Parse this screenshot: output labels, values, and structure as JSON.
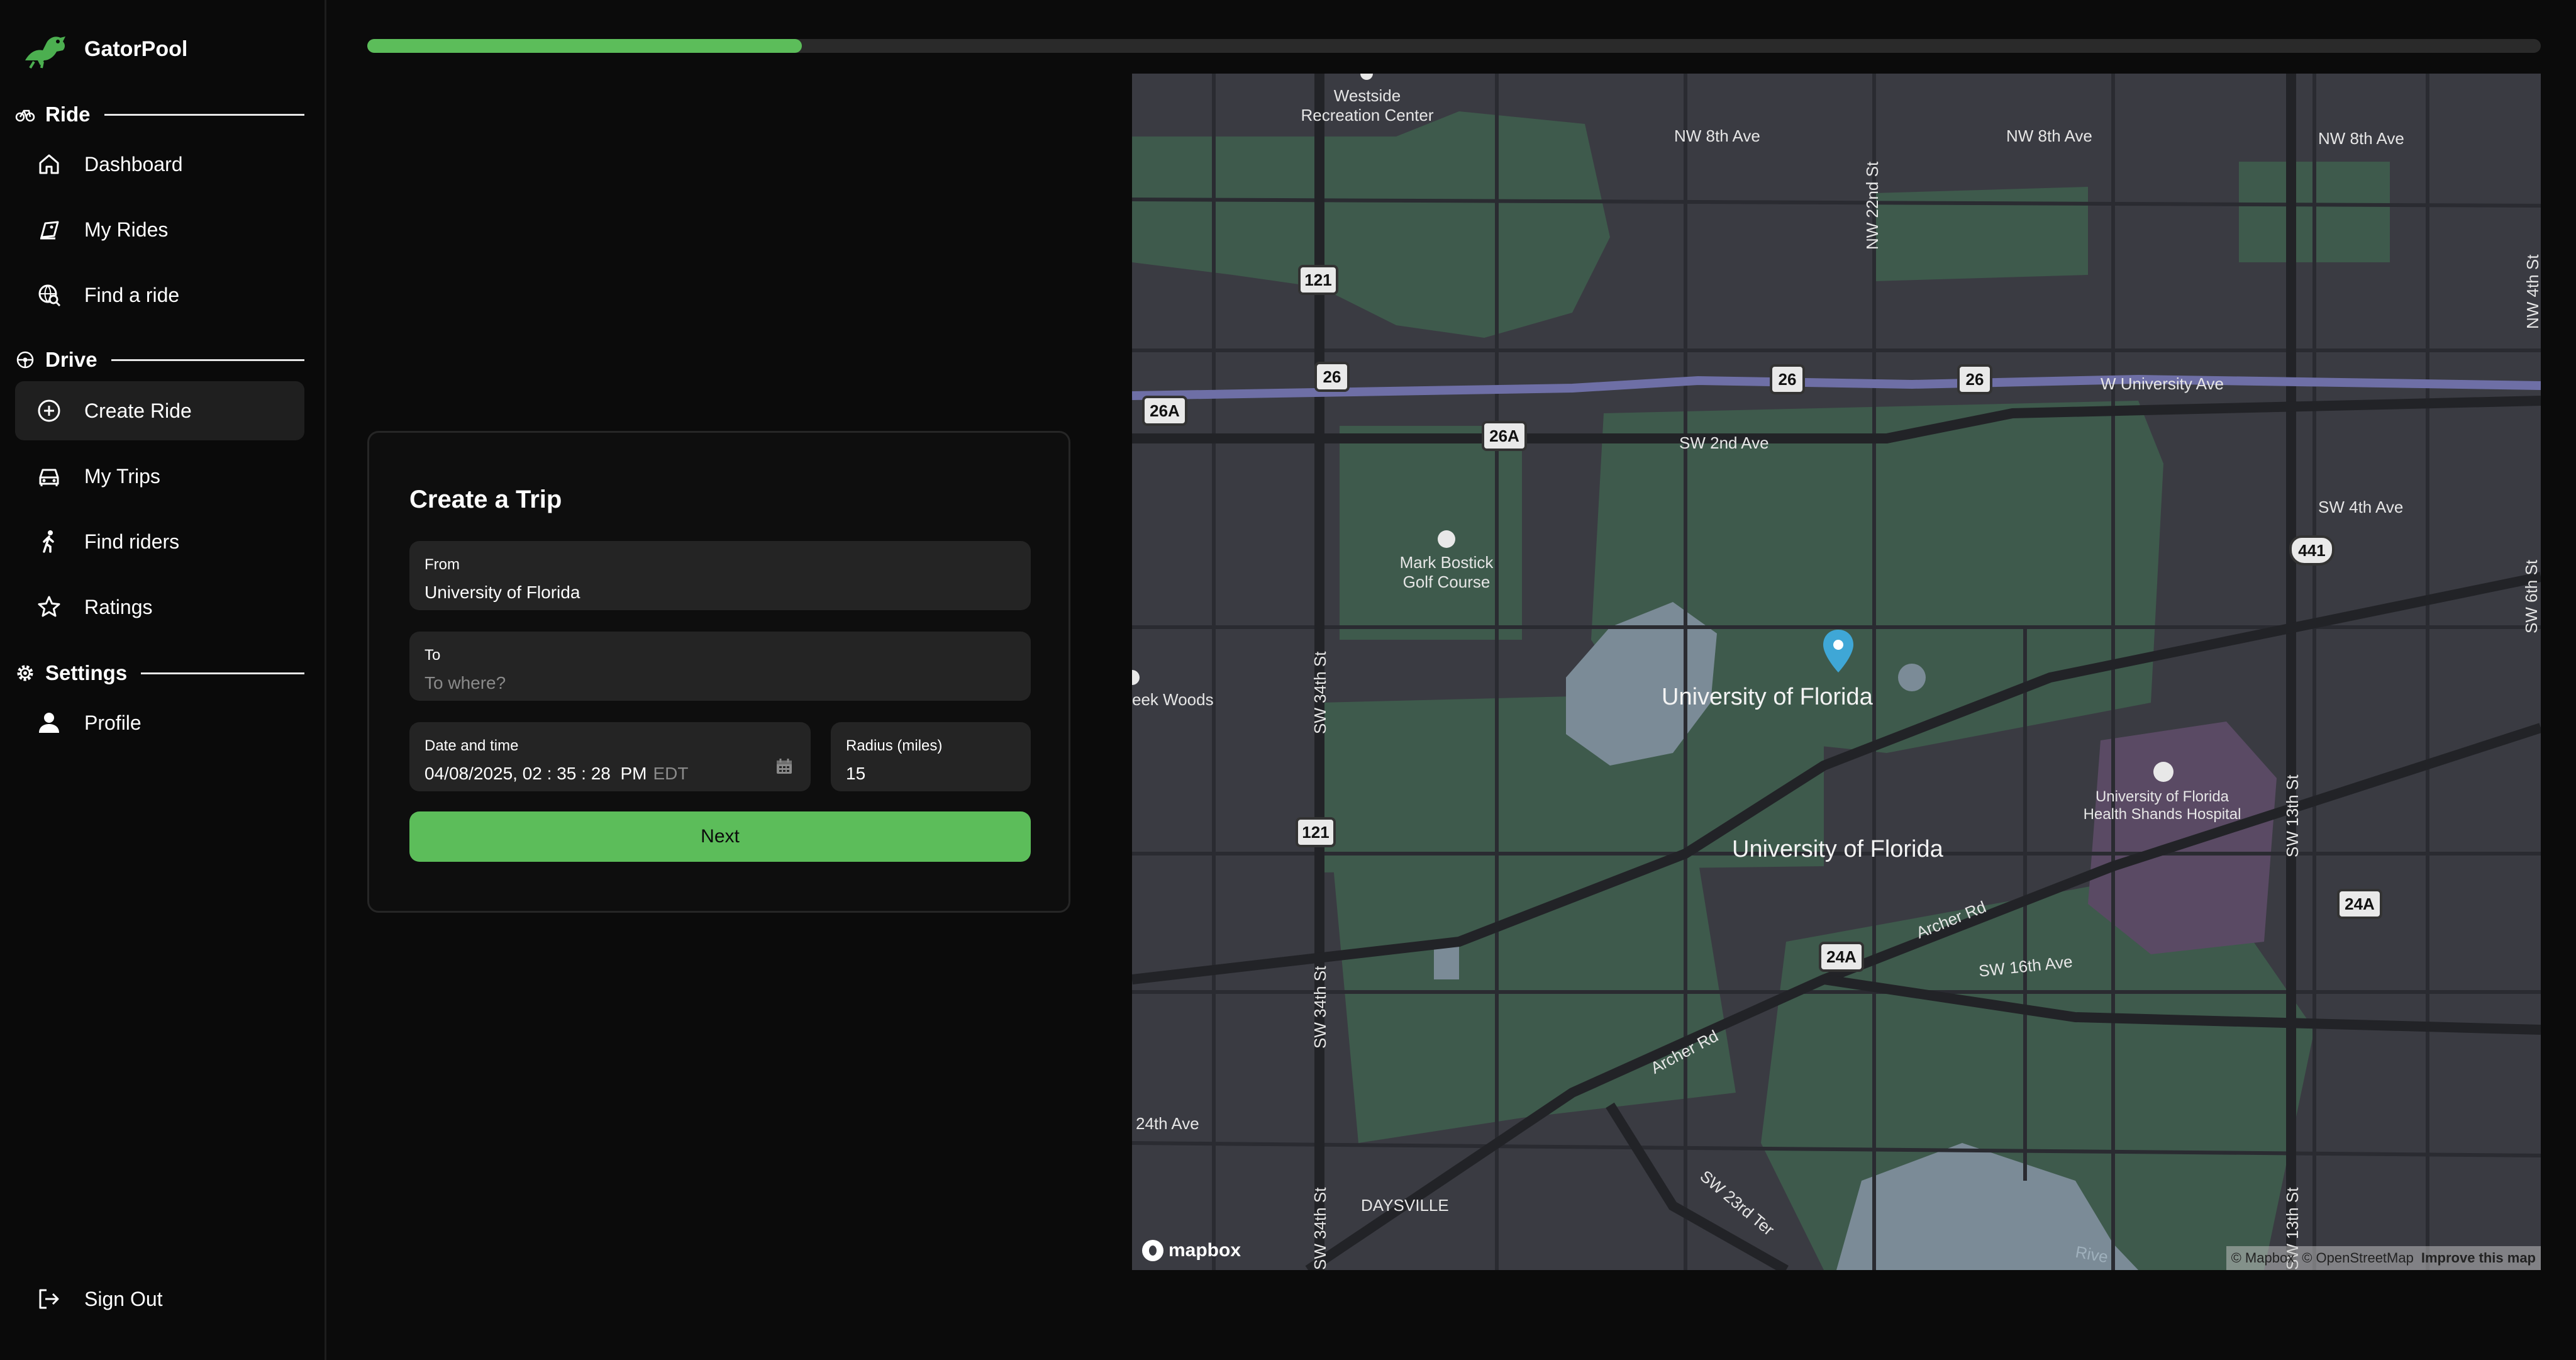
{
  "app": {
    "name": "GatorPool"
  },
  "colors": {
    "accent": "#5cbd5a",
    "background": "#0b0b0b",
    "field_bg": "#242424",
    "pin": "#3fa7d6"
  },
  "sidebar": {
    "sections": [
      {
        "label": "Ride",
        "icon": "bike-icon",
        "items": [
          {
            "label": "Dashboard",
            "icon": "home-icon"
          },
          {
            "label": "My Rides",
            "icon": "tag-icon"
          },
          {
            "label": "Find a ride",
            "icon": "globe-search-icon"
          }
        ]
      },
      {
        "label": "Drive",
        "icon": "steering-wheel-icon",
        "items": [
          {
            "label": "Create Ride",
            "icon": "plus-circle-icon",
            "active": true
          },
          {
            "label": "My Trips",
            "icon": "car-icon"
          },
          {
            "label": "Find riders",
            "icon": "person-walking-icon"
          },
          {
            "label": "Ratings",
            "icon": "star-icon"
          }
        ]
      },
      {
        "label": "Settings",
        "icon": "gear-icon",
        "items": [
          {
            "label": "Profile",
            "icon": "user-icon"
          }
        ]
      }
    ],
    "sign_out": {
      "label": "Sign Out",
      "icon": "sign-out-icon"
    }
  },
  "progress": {
    "fraction": 0.2
  },
  "trip_form": {
    "title": "Create a Trip",
    "from": {
      "label": "From",
      "value": "University of Florida"
    },
    "to": {
      "label": "To",
      "placeholder": "To where?"
    },
    "datetime": {
      "label": "Date and time",
      "month": "04",
      "day": "08",
      "year": "2025",
      "hour": "02",
      "minute": "35",
      "second": "28",
      "ampm": "PM",
      "tz": "EDT"
    },
    "radius": {
      "label": "Radius (miles)",
      "value": "15"
    },
    "next_label": "Next"
  },
  "map": {
    "labels": {
      "westside": "Westside\nRecreation Center",
      "nw8_1": "NW 8th Ave",
      "nw8_2": "NW 8th Ave",
      "nw8_3": "NW 8th Ave",
      "nw22": "NW 22nd St",
      "w_univ": "W University Ave",
      "sw2": "SW 2nd Ave",
      "sw4": "SW 4th Ave",
      "golf": "Mark Bostick\nGolf Course",
      "creek": "eek Woods",
      "uf_main": "University of Florida",
      "uf_second": "University of Florida",
      "hospital": "University of Florida\nHealth Shands Hospital",
      "sw34": "SW 34th St",
      "sw34b": "SW 34th St",
      "sw34c": "SW 34th St",
      "sw13": "SW 13th St",
      "sw13b": "SW 13th St",
      "sw6": "SW 6th St",
      "nw4": "NW 4th St",
      "archer1": "Archer Rd",
      "archer2": "Archer Rd",
      "sw16": "SW 16th Ave",
      "ave24": "24th Ave",
      "daysville": "DAYSVILLE",
      "sw23": "SW 23rd Ter",
      "river": "Rive"
    },
    "shields": {
      "s121a": "121",
      "s121b": "121",
      "s26a": "26",
      "s26b": "26",
      "s26c": "26",
      "s26Aa": "26A",
      "s26Ab": "26A",
      "s441": "441",
      "s24Aa": "24A",
      "s24Ab": "24A"
    },
    "logo": "mapbox",
    "attribution": {
      "mapbox": "© Mapbox",
      "osm": "© OpenStreetMap",
      "improve": "Improve this map"
    }
  }
}
